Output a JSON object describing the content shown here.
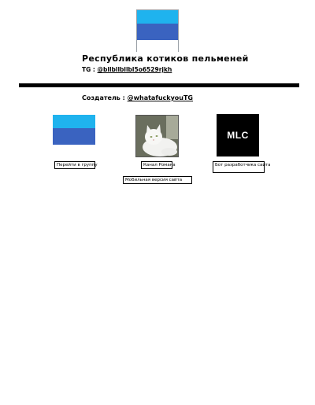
{
  "header": {
    "title": "Республика котиков пельменей",
    "tg_label": "TG : ",
    "tg_link": "@bllbllbllbl5o6529rjkh"
  },
  "creator": {
    "label": "Создатель : ",
    "link": "@whatafuckyouTG"
  },
  "cards": {
    "group_button": "Перейти в группу",
    "channel_button": "Канал Романа",
    "bot_button": "Бот разработчика сайта",
    "mlc_logo_text": "MLC"
  },
  "mobile_button": "Мобильная версия сайта",
  "colors": {
    "flag_top": "#1fb3ee",
    "flag_middle": "#3a63c0",
    "flag_bottom": "#ffffff",
    "divider": "#000000"
  },
  "icons": {
    "flag": "flag-image",
    "cat": "cat-photo",
    "mlc": "mlc-logo"
  }
}
